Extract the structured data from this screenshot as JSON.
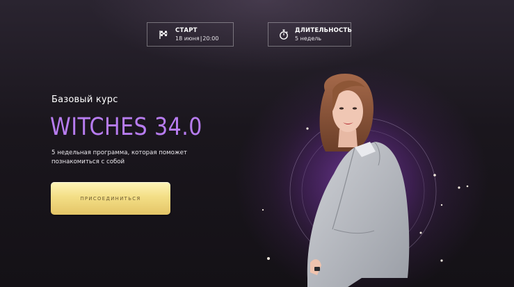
{
  "start": {
    "icon": "flag-icon",
    "label": "СТАРТ",
    "date": "18 июня",
    "separator": "|",
    "time": "20:00"
  },
  "duration": {
    "icon": "stopwatch-icon",
    "label": "ДЛИТЕЛЬНОСТЬ",
    "value": "5 недель"
  },
  "hero": {
    "subtitle": "Базовый курс",
    "title": "WITCHES 34.0",
    "description": "5 недельная программа, которая поможет познакомиться с собой",
    "cta_label": "ПРИСОЕДИНИТЬСЯ"
  },
  "colors": {
    "background": "#161318",
    "title": "#b77cf0",
    "button": "#f3de86",
    "button_text": "#6c5a2f"
  }
}
